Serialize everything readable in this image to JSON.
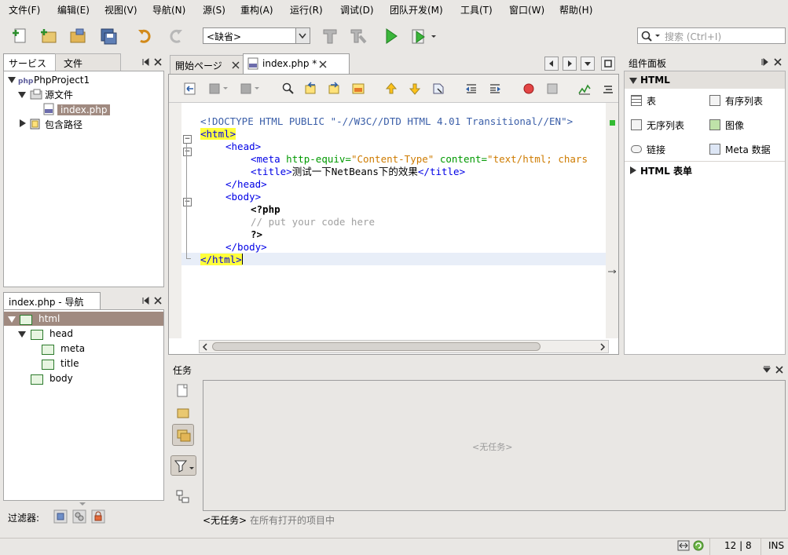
{
  "menu": [
    "文件(F)",
    "编辑(E)",
    "视图(V)",
    "导航(N)",
    "源(S)",
    "重构(A)",
    "运行(R)",
    "调试(D)",
    "团队开发(M)",
    "工具(T)",
    "窗口(W)",
    "帮助(H)"
  ],
  "toolbar": {
    "config_value": "<缺省>",
    "search_placeholder": "搜索 (Ctrl+I)"
  },
  "project_panel": {
    "tabs": [
      "サービス",
      "文件"
    ],
    "tree": {
      "project": "PhpProject1",
      "source": "源文件",
      "file": "index.php",
      "include": "包含路径"
    }
  },
  "navigator": {
    "title": "index.php - 导航",
    "items": [
      "html",
      "head",
      "meta",
      "title",
      "body"
    ],
    "filter_label": "过滤器:"
  },
  "editor": {
    "tabs": [
      "開始ページ",
      "index.php *"
    ],
    "lines": {
      "l1": "<!DOCTYPE HTML PUBLIC \"-//W3C//DTD HTML 4.01 Transitional//EN\">",
      "l2": "<html>",
      "l3_tag": "<head>",
      "l4_a": "<meta",
      "l4_b": " http-equiv=",
      "l4_c": "\"Content-Type\"",
      "l4_d": " content=",
      "l4_e": "\"text/html; chars",
      "l5_a": "<title>",
      "l5_b": "测试一下NetBeans下的效果",
      "l5_c": "</title>",
      "l6": "</head>",
      "l7": "<body>",
      "l8": "<?php",
      "l9": "// put your code here",
      "l10": "?>",
      "l11": "</body>",
      "l12": "</html>"
    }
  },
  "palette": {
    "title": "组件面板",
    "section_html": "HTML",
    "items": [
      "表",
      "有序列表",
      "无序列表",
      "图像",
      "链接",
      "Meta 数据"
    ],
    "section_form": "HTML 表单"
  },
  "tasks": {
    "title": "任务",
    "empty": "<无任务>",
    "footer_bold": "<无任务>",
    "footer_rest": " 在所有打开的项目中"
  },
  "status": {
    "position": "12 | 8",
    "mode": "INS"
  },
  "colors": {
    "selection": "#a08a80",
    "highlight": "#ffff3c",
    "caret_line": "#e8eef8"
  }
}
